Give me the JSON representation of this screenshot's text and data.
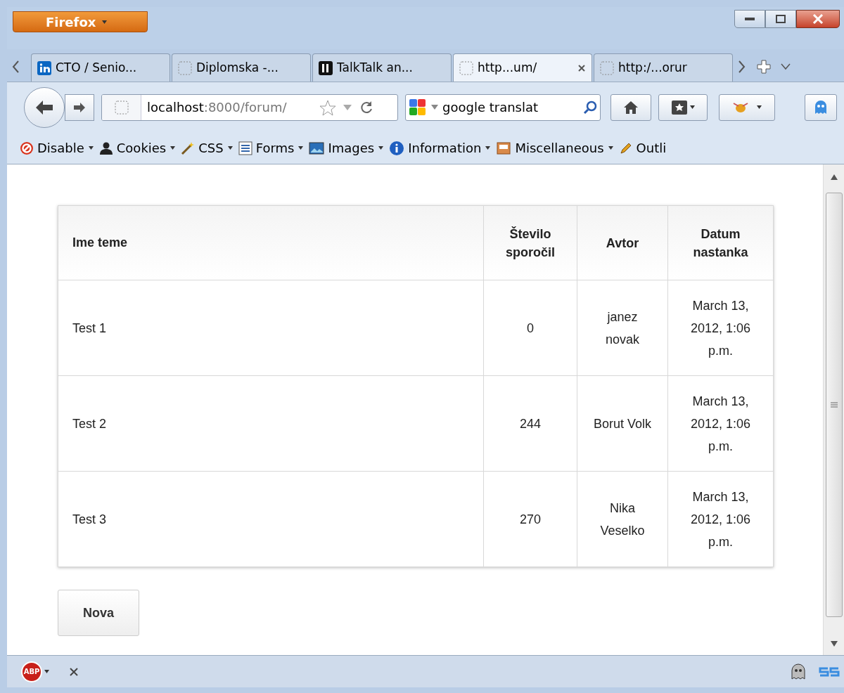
{
  "window": {
    "app_button": "Firefox"
  },
  "tabs": [
    {
      "label": "CTO / Senio...",
      "kind": "linkedin",
      "selected": false
    },
    {
      "label": "Diplomska -...",
      "kind": "blank",
      "selected": false
    },
    {
      "label": "TalkTalk an...",
      "kind": "dark",
      "selected": false
    },
    {
      "label": "http...um/",
      "kind": "blank",
      "selected": true
    },
    {
      "label": "http:/...orur",
      "kind": "blank",
      "selected": false
    }
  ],
  "address_bar": {
    "host": "localhost",
    "path": ":8000/forum/"
  },
  "search": {
    "value": "google translat"
  },
  "toolbar": [
    {
      "label": "Disable",
      "kind": "disable"
    },
    {
      "label": "Cookies",
      "kind": "person"
    },
    {
      "label": "CSS",
      "kind": "wand"
    },
    {
      "label": "Forms",
      "kind": "form"
    },
    {
      "label": "Images",
      "kind": "image"
    },
    {
      "label": "Information",
      "kind": "info"
    },
    {
      "label": "Miscellaneous",
      "kind": "box"
    },
    {
      "label": "Outli",
      "kind": "pencil"
    }
  ],
  "table": {
    "columns": [
      "Ime teme",
      "Število sporočil",
      "Avtor",
      "Datum nastanka"
    ],
    "rows": [
      [
        "Test 1",
        "0",
        "janez novak",
        "March 13, 2012, 1:06 p.m."
      ],
      [
        "Test 2",
        "244",
        "Borut Volk",
        "March 13, 2012, 1:06 p.m."
      ],
      [
        "Test 3",
        "270",
        "Nika Veselko",
        "March 13, 2012, 1:06 p.m."
      ]
    ]
  },
  "new_button": "Nova",
  "status_bar": {
    "adblock": "ABP"
  }
}
